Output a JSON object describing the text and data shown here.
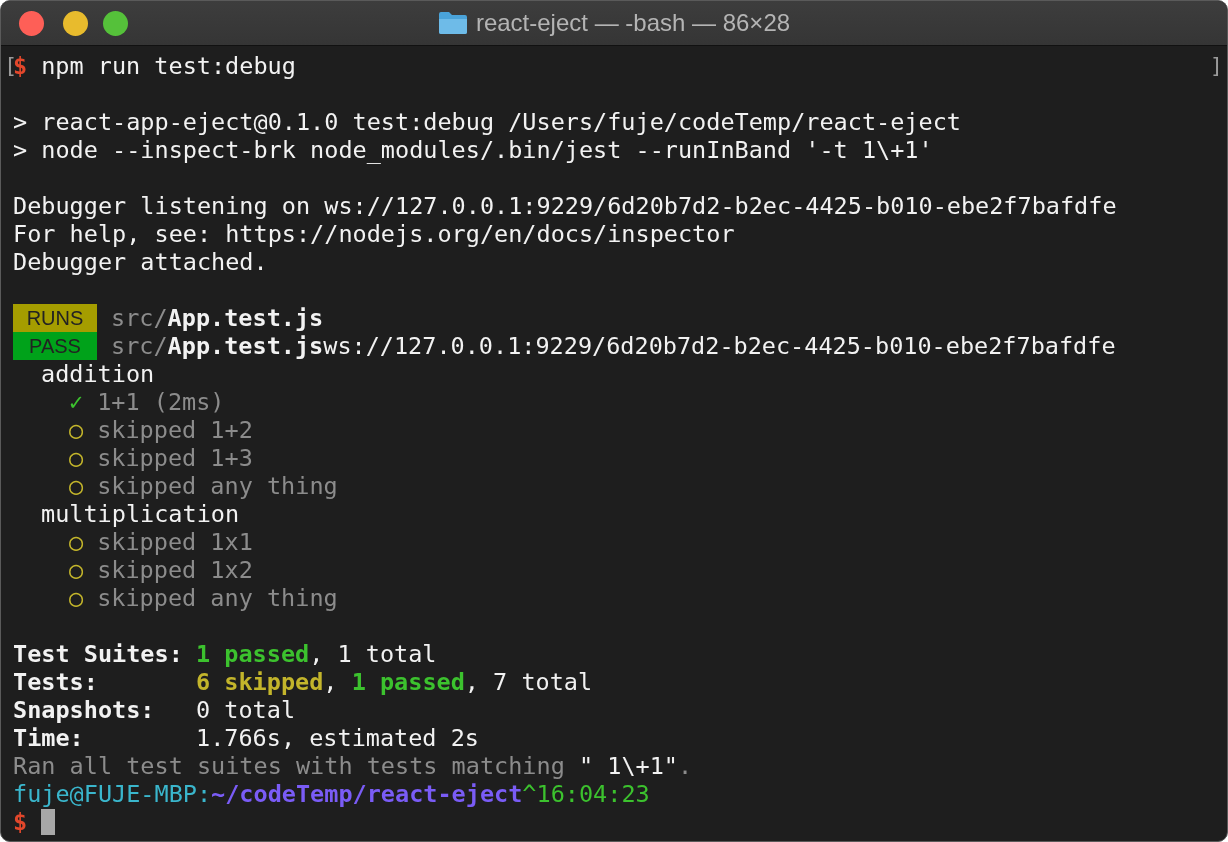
{
  "window": {
    "title": "react-eject — -bash — 86×28"
  },
  "terminal": {
    "command_line": {
      "open_mark": "[",
      "prompt": "$",
      "command": "npm run test:debug",
      "close_mark": "]"
    },
    "script_lines": [
      "> react-app-eject@0.1.0 test:debug /Users/fuje/codeTemp/react-eject",
      "> node --inspect-brk node_modules/.bin/jest --runInBand '-t 1\\+1'"
    ],
    "debugger_lines": [
      "Debugger listening on ws://127.0.0.1:9229/6d20b7d2-b2ec-4425-b010-ebe2f7bafdfe",
      "For help, see: https://nodejs.org/en/docs/inspector",
      "Debugger attached."
    ],
    "suites": [
      {
        "badge": "RUNS",
        "kind": "runs",
        "path": "src/",
        "file": "App.test.js"
      },
      {
        "badge": "PASS",
        "kind": "pass",
        "path": "src/",
        "file": "App.test.js",
        "trailing": "ws://127.0.0.1:9229/6d20b7d2-b2ec-4425-b010-ebe2f7bafdfe"
      }
    ],
    "results": [
      {
        "name": "addition",
        "children": [
          {
            "kind": "passed",
            "mark": "✓",
            "text": "1+1 (2ms)"
          },
          {
            "kind": "skipped",
            "mark": "○",
            "text": "skipped 1+2"
          },
          {
            "kind": "skipped",
            "mark": "○",
            "text": "skipped 1+3"
          },
          {
            "kind": "skipped",
            "mark": "○",
            "text": "skipped any thing"
          }
        ]
      },
      {
        "name": "multiplication",
        "children": [
          {
            "kind": "skipped",
            "mark": "○",
            "text": "skipped 1x1"
          },
          {
            "kind": "skipped",
            "mark": "○",
            "text": "skipped 1x2"
          },
          {
            "kind": "skipped",
            "mark": "○",
            "text": "skipped any thing"
          }
        ]
      }
    ],
    "summary": [
      {
        "label": "Test Suites:",
        "parts": [
          {
            "kind": "passed",
            "text": "1 passed"
          },
          {
            "kind": "plain",
            "text": ", 1 total"
          }
        ]
      },
      {
        "label": "Tests:",
        "parts": [
          {
            "kind": "skipped",
            "text": "6 skipped"
          },
          {
            "kind": "plain",
            "text": ", "
          },
          {
            "kind": "passed",
            "text": "1 passed"
          },
          {
            "kind": "plain",
            "text": ", 7 total"
          }
        ]
      },
      {
        "label": "Snapshots:",
        "parts": [
          {
            "kind": "plain",
            "text": "0 total"
          }
        ]
      },
      {
        "label": "Time:",
        "parts": [
          {
            "kind": "plain",
            "text": "1.766s, estimated 2s"
          }
        ]
      }
    ],
    "ran_line": [
      {
        "kind": "dim",
        "text": "Ran all test suites with tests matching "
      },
      {
        "kind": "plain",
        "text": "\" 1\\+1\""
      },
      {
        "kind": "dim",
        "text": "."
      }
    ],
    "prompt_info": {
      "user_host": "fuje@FUJE-MBP:",
      "path": "~/codeTemp/react-eject",
      "time": "^16:04:23"
    },
    "input_prompt": "$"
  }
}
